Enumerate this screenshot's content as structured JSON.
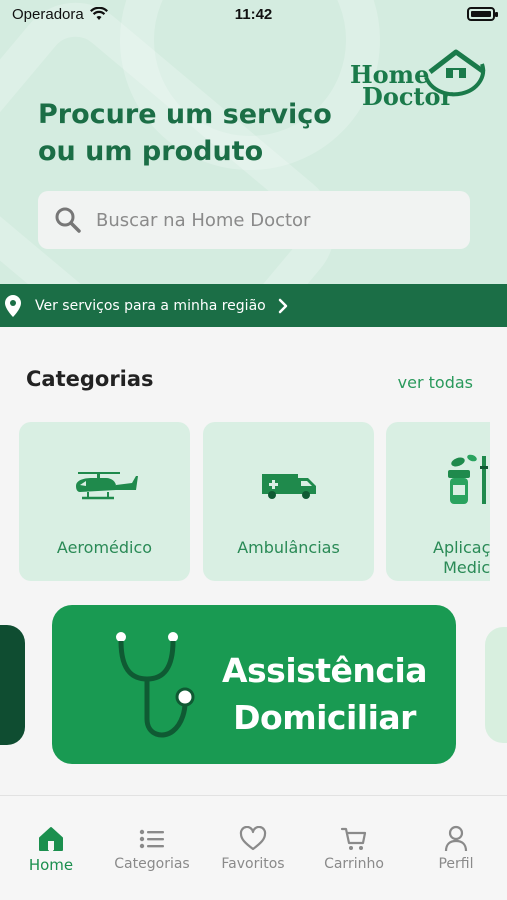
{
  "status_bar": {
    "carrier": "Operadora",
    "time": "11:42"
  },
  "logo": {
    "line1": "Home",
    "line2": "Doctor"
  },
  "hero": {
    "title": "Procure um serviço\n ou um produto"
  },
  "search": {
    "placeholder": "Buscar na Home Doctor"
  },
  "region": {
    "label": "Ver serviços para a minha região"
  },
  "categories": {
    "title": "Categorias",
    "see_all": "ver todas",
    "items": [
      {
        "label": "Aeromédico",
        "icon": "helicopter-icon"
      },
      {
        "label": "Ambulâncias",
        "icon": "ambulance-icon"
      },
      {
        "label": "Aplicação\nMedica",
        "icon": "medication-icon"
      }
    ]
  },
  "banner": {
    "text": "Assistência\nDomiciliar",
    "icon": "stethoscope-icon"
  },
  "bottom_nav": {
    "items": [
      {
        "label": "Home",
        "icon": "home-icon",
        "active": true
      },
      {
        "label": "Categorias",
        "icon": "list-icon",
        "active": false
      },
      {
        "label": "Favoritos",
        "icon": "heart-icon",
        "active": false
      },
      {
        "label": "Carrinho",
        "icon": "cart-icon",
        "active": false
      },
      {
        "label": "Perfil",
        "icon": "user-icon",
        "active": false
      }
    ]
  },
  "colors": {
    "brand_green": "#1b6e46",
    "accent_green": "#199a52",
    "hero_bg": "#d4ece0",
    "card_bg": "#d9efe3"
  }
}
